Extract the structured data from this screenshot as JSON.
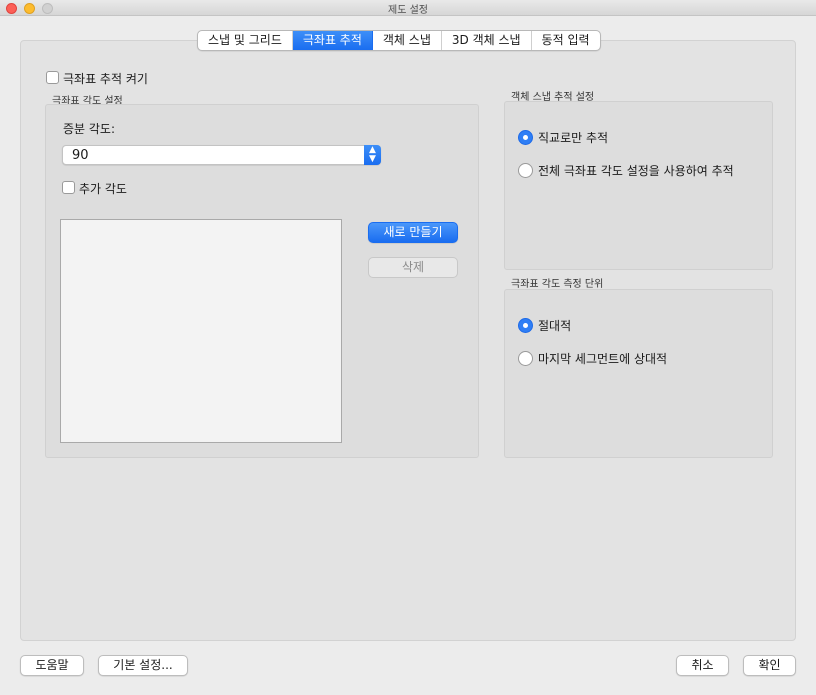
{
  "window": {
    "title": "제도 설정"
  },
  "tabs": [
    {
      "label": "스냅 및 그리드"
    },
    {
      "label": "극좌표 추적",
      "active": true
    },
    {
      "label": "객체 스냅"
    },
    {
      "label": "3D 객체 스냅"
    },
    {
      "label": "동적 입력"
    }
  ],
  "polar": {
    "enable_label": "극좌표 추적 켜기",
    "enabled": false,
    "angle_settings_title": "극좌표 각도 설정",
    "increment_label": "증분 각도:",
    "increment_value": "90",
    "additional_label": "추가 각도",
    "additional_checked": false,
    "additional_angles": [],
    "new_button": "새로 만들기",
    "delete_button": "삭제"
  },
  "osnap_tracking": {
    "title": "객체 스냅 추적 설정",
    "options": [
      {
        "label": "직교로만 추적",
        "selected": true
      },
      {
        "label": "전체 극좌표 각도 설정을 사용하여 추적",
        "selected": false
      }
    ]
  },
  "measurement": {
    "title": "극좌표 각도 측정 단위",
    "options": [
      {
        "label": "절대적",
        "selected": true
      },
      {
        "label": "마지막 세그먼트에 상대적",
        "selected": false
      }
    ]
  },
  "footer": {
    "help": "도움말",
    "defaults": "기본 설정...",
    "cancel": "취소",
    "ok": "확인"
  },
  "colors": {
    "accent": "#1a6df0",
    "panel": "#e3e3e3",
    "group": "#dddddd",
    "close": "#fc5f57",
    "minimize": "#fdbc2e",
    "maximize": "#d1d1d1"
  }
}
